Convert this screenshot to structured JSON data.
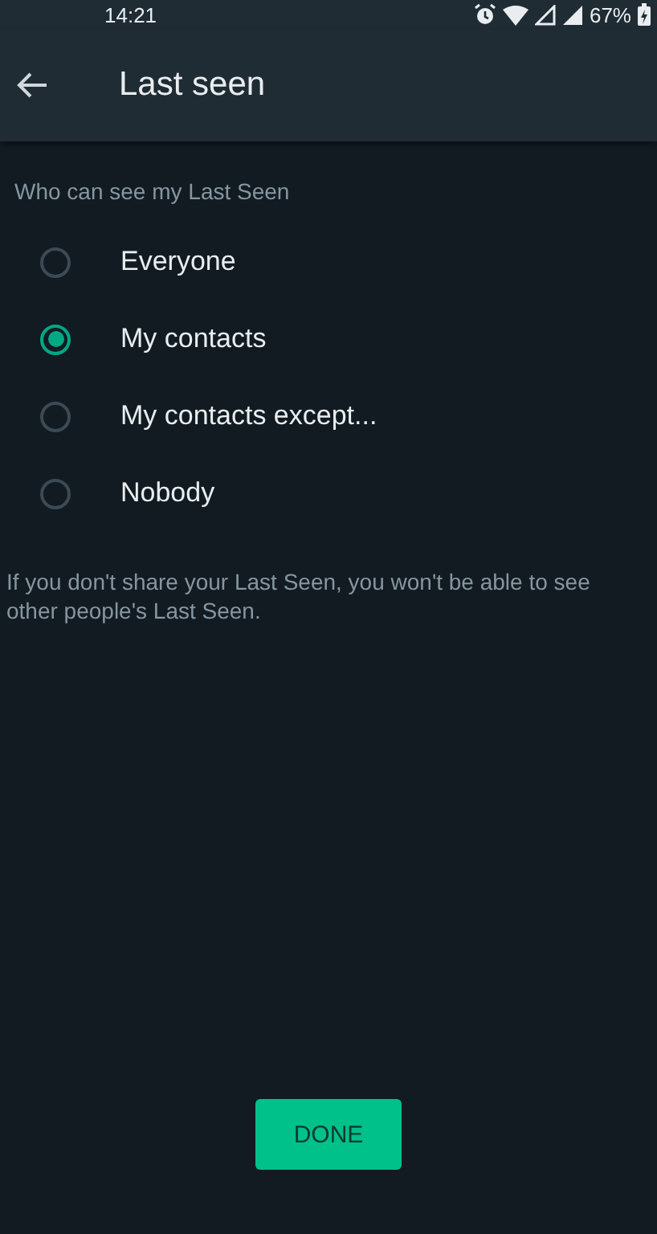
{
  "status_bar": {
    "time": "14:21",
    "battery": "67%"
  },
  "app_bar": {
    "title": "Last seen"
  },
  "section_title": "Who can see my Last Seen",
  "options": [
    {
      "label": "Everyone",
      "selected": false
    },
    {
      "label": "My contacts",
      "selected": true
    },
    {
      "label": "My contacts except...",
      "selected": false
    },
    {
      "label": "Nobody",
      "selected": false
    }
  ],
  "note": "If you don't share your Last Seen, you won't be able to see other people's Last Seen.",
  "buttons": [
    {
      "label": "DONE"
    }
  ]
}
